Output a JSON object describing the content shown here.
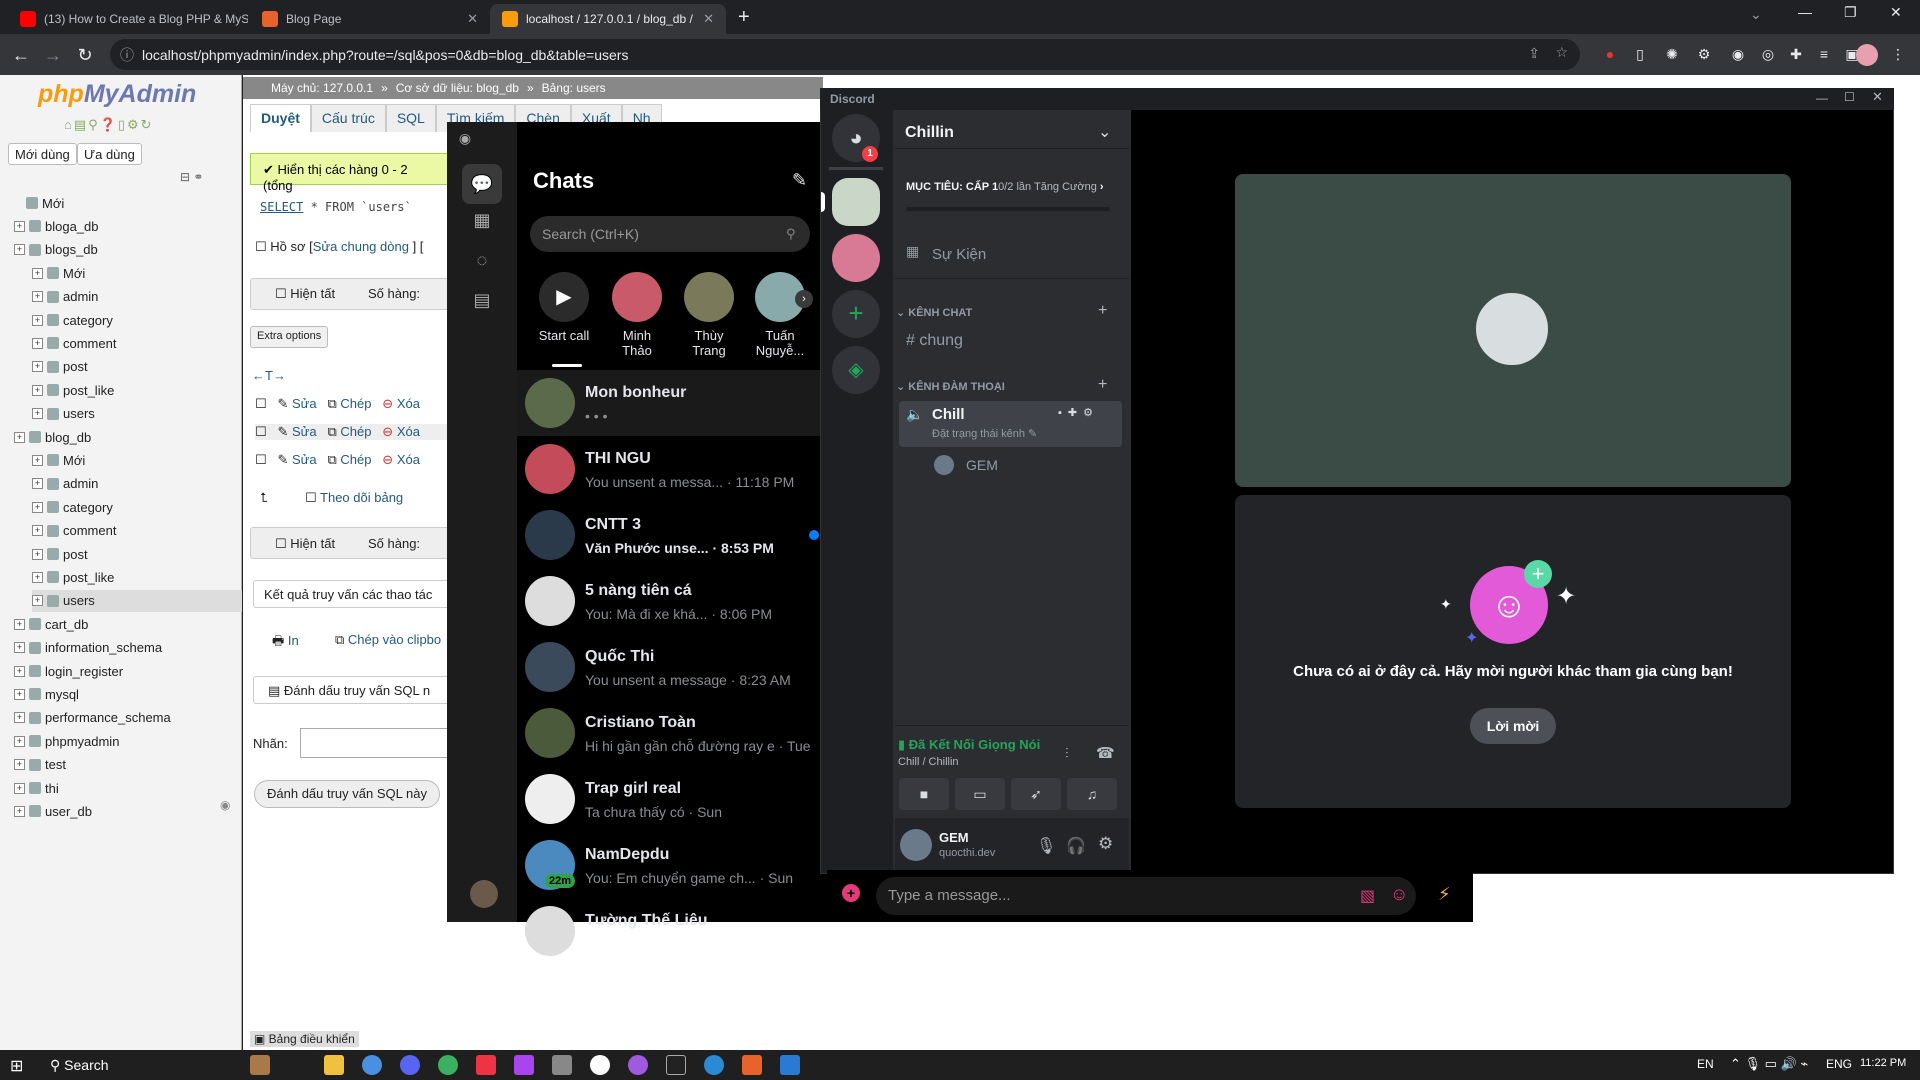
{
  "browser": {
    "tabs": [
      {
        "title": "(13) How to Create a Blog PHP & MySQL..."
      },
      {
        "title": "Blog Page"
      },
      {
        "title": "localhost / 127.0.0.1 / blog_db / users"
      }
    ],
    "url": "localhost/phpmyadmin/index.php?route=/sql&pos=0&db=blog_db&table=users",
    "new_tab": "+"
  },
  "pma": {
    "logo_php": "php",
    "logo_myadmin": "MyAdmin",
    "recent_label": "Mới dùng",
    "favorites_label": "Ưa dùng",
    "breadcrumb": {
      "server": "Máy chủ: 127.0.0.1",
      "database": "Cơ sở dữ liệu: blog_db",
      "table": "Bảng: users"
    },
    "tabs": [
      "Duyệt",
      "Cấu trúc",
      "SQL",
      "Tìm kiếm",
      "Chèn",
      "Xuất",
      "Nh"
    ],
    "tree": [
      {
        "label": "Mới",
        "level": 1
      },
      {
        "label": "bloga_db",
        "level": 0
      },
      {
        "label": "blogs_db",
        "level": 0
      },
      {
        "label": "Mới",
        "level": 2
      },
      {
        "label": "admin",
        "level": 2
      },
      {
        "label": "category",
        "level": 2
      },
      {
        "label": "comment",
        "level": 2
      },
      {
        "label": "post",
        "level": 2
      },
      {
        "label": "post_like",
        "level": 2
      },
      {
        "label": "users",
        "level": 2
      },
      {
        "label": "blog_db",
        "level": 0
      },
      {
        "label": "Mới",
        "level": 2
      },
      {
        "label": "admin",
        "level": 2
      },
      {
        "label": "category",
        "level": 2
      },
      {
        "label": "comment",
        "level": 2
      },
      {
        "label": "post",
        "level": 2
      },
      {
        "label": "post_like",
        "level": 2
      },
      {
        "label": "users",
        "level": 2
      },
      {
        "label": "cart_db",
        "level": 0
      },
      {
        "label": "information_schema",
        "level": 0
      },
      {
        "label": "login_register",
        "level": 0
      },
      {
        "label": "mysql",
        "level": 0
      },
      {
        "label": "performance_schema",
        "level": 0
      },
      {
        "label": "phpmyadmin",
        "level": 0
      },
      {
        "label": "test",
        "level": 0
      },
      {
        "label": "thi",
        "level": 0
      },
      {
        "label": "user_db",
        "level": 0
      }
    ],
    "success_msg": "Hiển thị các hàng 0 - 2 (tổng",
    "sql_select": "SELECT",
    "sql_rest": "* FROM `users`",
    "profile_label": "Hồ sơ [",
    "inline_edit": "Sửa chung dòng",
    "profile_tail": "] [",
    "show_all": "Hiện tất",
    "rows_label": "Số hàng:",
    "extra_options": "Extra options",
    "row_actions": {
      "edit": "Sửa",
      "copy": "Chép",
      "delete": "Xóa"
    },
    "track_table": "Theo dõi bảng",
    "query_results": "Kết quả truy vấn các thao tác",
    "print": "In",
    "copy_clipboard": "Chép vào clipbo",
    "bookmark_section": "Đánh dấu truy vấn SQL n",
    "label_field": "Nhãn:",
    "bookmark_button": "Đánh dấu truy vấn SQL này",
    "console": "Bảng điều khiển"
  },
  "messenger": {
    "title": "Chats",
    "search_placeholder": "Search (Ctrl+K)",
    "stories": [
      {
        "name": "Start call"
      },
      {
        "name": "Minh Thảo"
      },
      {
        "name": "Thùy Trang"
      },
      {
        "name": "Tuấn Nguyễ..."
      }
    ],
    "chats": [
      {
        "name": "Mon bonheur",
        "preview": "• • •",
        "time": "",
        "unread": false,
        "color": "#5a6a4a"
      },
      {
        "name": "THI NGU",
        "preview": "You unsent a messa... · 11:18 PM",
        "unread": false,
        "color": "#c44b5a"
      },
      {
        "name": "CNTT 3",
        "preview": "Văn Phước unse... · 8:53 PM",
        "unread": true,
        "color": "#2a3a4a"
      },
      {
        "name": "5 nàng tiên cá",
        "preview": "You: Mà đi xe khá... · 8:06 PM",
        "unread": false,
        "color": "#ddd"
      },
      {
        "name": "Quốc Thi",
        "preview": "You unsent a message · 8:23 AM",
        "unread": false,
        "color": "#3a4a5a"
      },
      {
        "name": "Cristiano Toàn",
        "preview": "Hi hi gần gần chỗ đường ray e · Tue",
        "unread": false,
        "color": "#4a5a3a"
      },
      {
        "name": "Trap girl real",
        "preview": "Ta chưa thấy có · Sun",
        "unread": false,
        "color": "#eee"
      },
      {
        "name": "NamDepdu",
        "preview": "You: Em chuyển game ch... · Sun",
        "unread": false,
        "color": "#4a8abf"
      },
      {
        "name": "Tường Thế Liêu",
        "preview": "",
        "unread": false,
        "color": "#ddd"
      }
    ],
    "namdepdu_badge": "22m"
  },
  "discord": {
    "window_title": "Discord",
    "server_name": "Chillin",
    "boost_goal_prefix": "MỤC TIÊU: CẤP 1",
    "boost_goal_count": "0/2 lần Tăng Cường",
    "events": "Sự Kiện",
    "text_category": "KÊNH CHAT",
    "text_channel": "chung",
    "voice_category": "KÊNH ĐÀM THOẠI",
    "voice_channel": "Chill",
    "voice_status": "Đặt trạng thái kênh",
    "voice_member": "GEM",
    "connected": "Đã Kết Nối Giọng Nói",
    "connected_sub": "Chill / Chillin",
    "user_name": "GEM",
    "user_tag": "quocthi.dev",
    "empty_msg": "Chưa có ai ở đây cả. Hãy mời người khác tham gia cùng bạn!",
    "invite": "Lời mời",
    "notif_count": "1",
    "message_placeholder": "Type a message..."
  },
  "taskbar": {
    "search": "Search",
    "lang1": "EN",
    "lang2": "ENG",
    "time": "11:22 PM"
  },
  "colors": {
    "discord_green": "#23a55a",
    "messenger_blue": "#0a7cff",
    "pma_link": "#235a81"
  }
}
